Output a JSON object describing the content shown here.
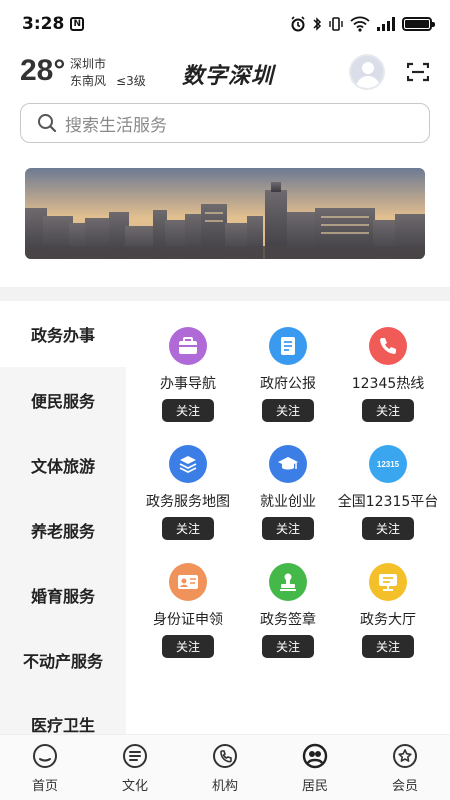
{
  "status_bar": {
    "time": "3:28"
  },
  "header": {
    "temperature": "28°",
    "city": "深圳市",
    "wind_direction": "东南风",
    "wind_level": "≤3级",
    "app_title": "数字深圳"
  },
  "search": {
    "placeholder": "搜索生活服务"
  },
  "categories": [
    {
      "label": "政务办事",
      "active": true
    },
    {
      "label": "便民服务",
      "active": false
    },
    {
      "label": "文体旅游",
      "active": false
    },
    {
      "label": "养老服务",
      "active": false
    },
    {
      "label": "婚育服务",
      "active": false
    },
    {
      "label": "不动产服务",
      "active": false
    },
    {
      "label": "医疗卫生",
      "active": false
    }
  ],
  "follow_label": "关注",
  "services": [
    {
      "label": "办事导航",
      "icon": "briefcase-icon",
      "color": "#b06ad8"
    },
    {
      "label": "政府公报",
      "icon": "document-icon",
      "color": "#3a9af0"
    },
    {
      "label": "12345热线",
      "icon": "phone-icon",
      "color": "#f05b58"
    },
    {
      "label": "政务服务地图",
      "icon": "layers-icon",
      "color": "#3b7fe6"
    },
    {
      "label": "就业创业",
      "icon": "graduation-cap-icon",
      "color": "#3b7fe6"
    },
    {
      "label": "全国12315平台",
      "icon": "badge-12315-icon",
      "icon_text": "12315",
      "color": "#3aa6f0"
    },
    {
      "label": "身份证申领",
      "icon": "id-card-icon",
      "color": "#f0935a"
    },
    {
      "label": "政务签章",
      "icon": "stamp-icon",
      "color": "#45b84a"
    },
    {
      "label": "政务大厅",
      "icon": "hall-screen-icon",
      "color": "#f4c02a"
    }
  ],
  "bottom_nav": [
    {
      "label": "首页",
      "icon": "home-icon"
    },
    {
      "label": "文化",
      "icon": "culture-icon"
    },
    {
      "label": "机构",
      "icon": "institution-icon"
    },
    {
      "label": "居民",
      "icon": "resident-icon"
    },
    {
      "label": "会员",
      "icon": "member-icon"
    }
  ]
}
